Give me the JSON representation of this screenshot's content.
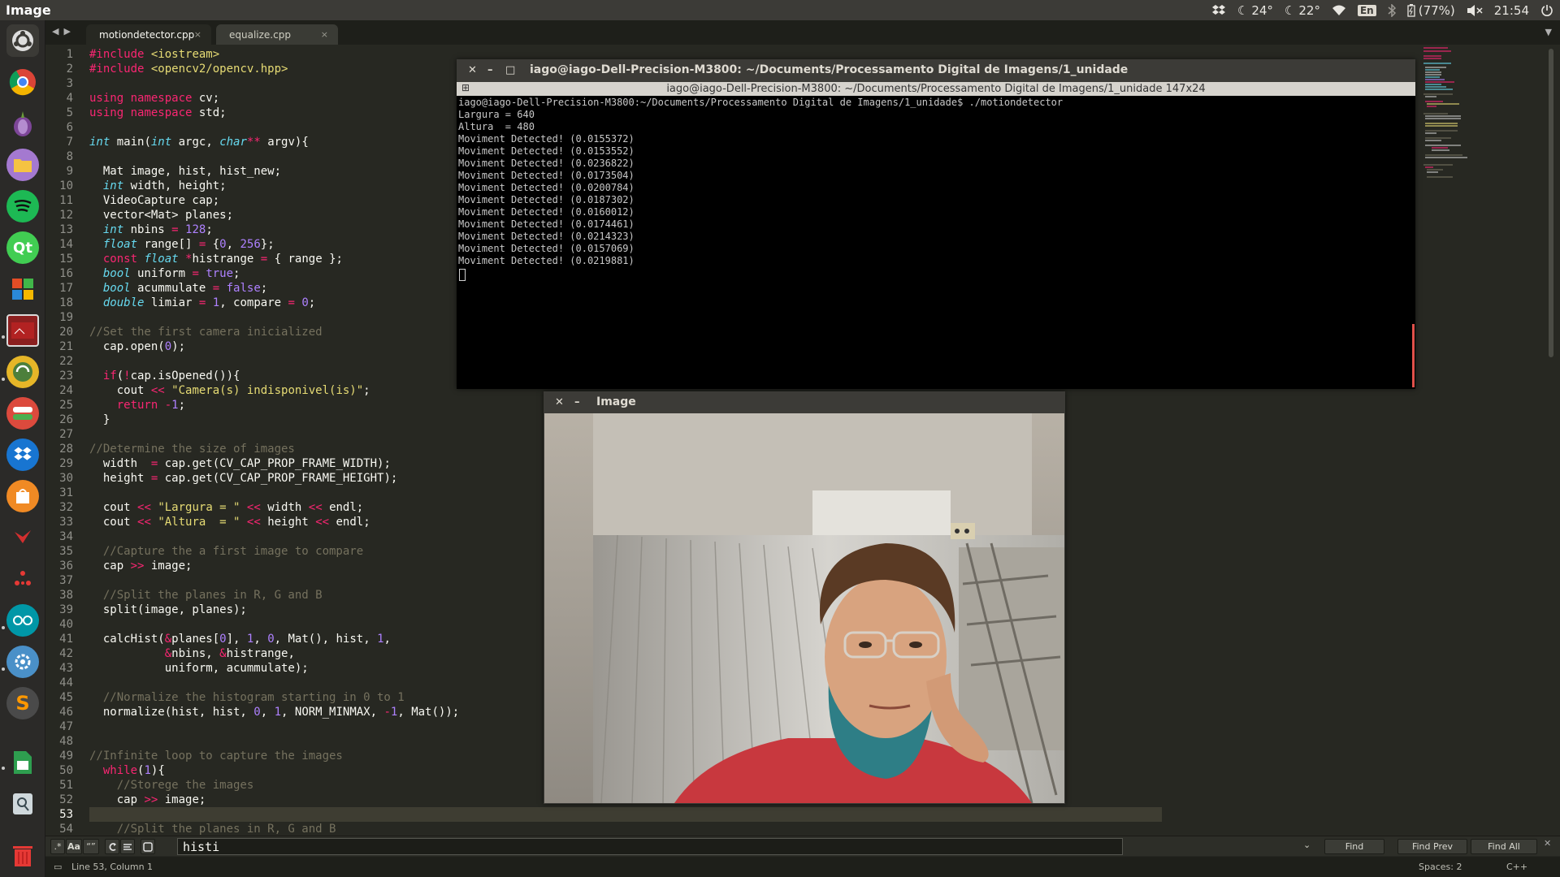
{
  "top_panel": {
    "app_title": "Image",
    "temp1": "24°",
    "temp2": "22°",
    "lang": "En",
    "battery": "(77%)",
    "time": "21:54"
  },
  "editor": {
    "tabs": [
      {
        "label": "motiondetector.cpp",
        "close": "×"
      },
      {
        "label": "equalize.cpp",
        "close": "×"
      }
    ],
    "line_numbers": [
      "1",
      "2",
      "3",
      "4",
      "5",
      "6",
      "7",
      "8",
      "9",
      "10",
      "11",
      "12",
      "13",
      "14",
      "15",
      "16",
      "17",
      "18",
      "19",
      "20",
      "21",
      "22",
      "23",
      "24",
      "25",
      "26",
      "27",
      "28",
      "29",
      "30",
      "31",
      "32",
      "33",
      "34",
      "35",
      "36",
      "37",
      "38",
      "39",
      "40",
      "41",
      "42",
      "43",
      "44",
      "45",
      "46",
      "47",
      "48",
      "49",
      "50",
      "51",
      "52",
      "53",
      "54"
    ],
    "current_line": 53,
    "code_lines": [
      "#include <iostream>",
      "#include <opencv2/opencv.hpp>",
      "",
      "using namespace cv;",
      "using namespace std;",
      "",
      "int main(int argc, char** argv){",
      "",
      "  Mat image, hist, hist_new;",
      "  int width, height;",
      "  VideoCapture cap;",
      "  vector<Mat> planes;",
      "  int nbins = 128;",
      "  float range[] = {0, 256};",
      "  const float *histrange = { range };",
      "  bool uniform = true;",
      "  bool acummulate = false;",
      "  double limiar = 1, compare = 0;",
      "",
      "//Set the first camera inicialized",
      "  cap.open(0);",
      "",
      "  if(!cap.isOpened()){",
      "    cout << \"Camera(s) indisponivel(is)\";",
      "    return -1;",
      "  }",
      "",
      "//Determine the size of images",
      "  width  = cap.get(CV_CAP_PROP_FRAME_WIDTH);",
      "  height = cap.get(CV_CAP_PROP_FRAME_HEIGHT);",
      "",
      "  cout << \"Largura = \" << width << endl;",
      "  cout << \"Altura  = \" << height << endl;",
      "",
      "  //Capture the a first image to compare",
      "  cap >> image;",
      "",
      "  //Split the planes in R, G and B",
      "  split(image, planes);",
      "",
      "  calcHist(&planes[0], 1, 0, Mat(), hist, 1,",
      "           &nbins, &histrange,",
      "           uniform, acummulate);",
      "",
      "  //Normalize the histogram starting in 0 to 1",
      "  normalize(hist, hist, 0, 1, NORM_MINMAX, -1, Mat());",
      "",
      "",
      "//Infinite loop to capture the images",
      "  while(1){",
      "    //Storege the images",
      "    cap >> image;",
      "",
      "    //Split the planes in R, G and B"
    ]
  },
  "find_panel": {
    "query": "histi",
    "opt_case": "Aa",
    "opt_word": "“”",
    "find": "Find",
    "find_prev": "Find Prev",
    "find_all": "Find All"
  },
  "status_bar": {
    "position": "Line 53, Column 1",
    "spaces": "Spaces: 2",
    "syntax": "C++"
  },
  "terminal": {
    "title": "iago@iago-Dell-Precision-M3800: ~/Documents/Processamento Digital de Imagens/1_unidade",
    "tab_title": "iago@iago-Dell-Precision-M3800: ~/Documents/Processamento Digital de Imagens/1_unidade 147x24",
    "lines": [
      "iago@iago-Dell-Precision-M3800:~/Documents/Processamento Digital de Imagens/1_unidade$ ./motiondetector",
      "Largura = 640",
      "Altura  = 480",
      "Moviment Detected! (0.0155372)",
      "Moviment Detected! (0.0153552)",
      "Moviment Detected! (0.0236822)",
      "Moviment Detected! (0.0173504)",
      "Moviment Detected! (0.0200784)",
      "Moviment Detected! (0.0187302)",
      "Moviment Detected! (0.0160012)",
      "Moviment Detected! (0.0174461)",
      "Moviment Detected! (0.0214323)",
      "Moviment Detected! (0.0157069)",
      "Moviment Detected! (0.0219881)"
    ]
  },
  "image_window": {
    "title": "Image"
  },
  "colors": {
    "editor_bg": "#272822",
    "keyword": "#f92672",
    "type": "#66d9ef",
    "string": "#e6db74",
    "number": "#ae81ff",
    "comment": "#75715e",
    "panel": "#3c3b37"
  }
}
